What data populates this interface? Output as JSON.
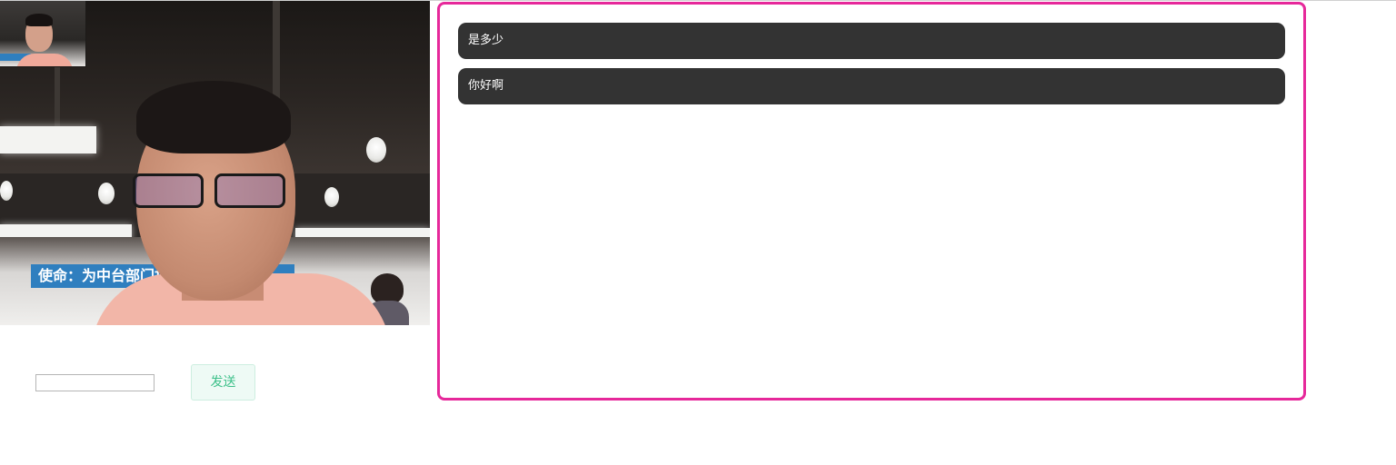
{
  "video": {
    "remote_banner_text": "使命：为中台部门打",
    "icons": {
      "remote": "remote-video-feed",
      "local": "local-video-preview"
    }
  },
  "composer": {
    "input_value": "",
    "input_placeholder": "",
    "send_label": "发送"
  },
  "chat": {
    "messages": [
      {
        "text": "是多少"
      },
      {
        "text": "你好啊"
      }
    ]
  },
  "colors": {
    "chat_border": "#e6289a",
    "message_bg": "#333333",
    "message_text": "#ffffff",
    "send_button_text": "#3ec08a",
    "send_button_bg": "#eefaf5"
  }
}
